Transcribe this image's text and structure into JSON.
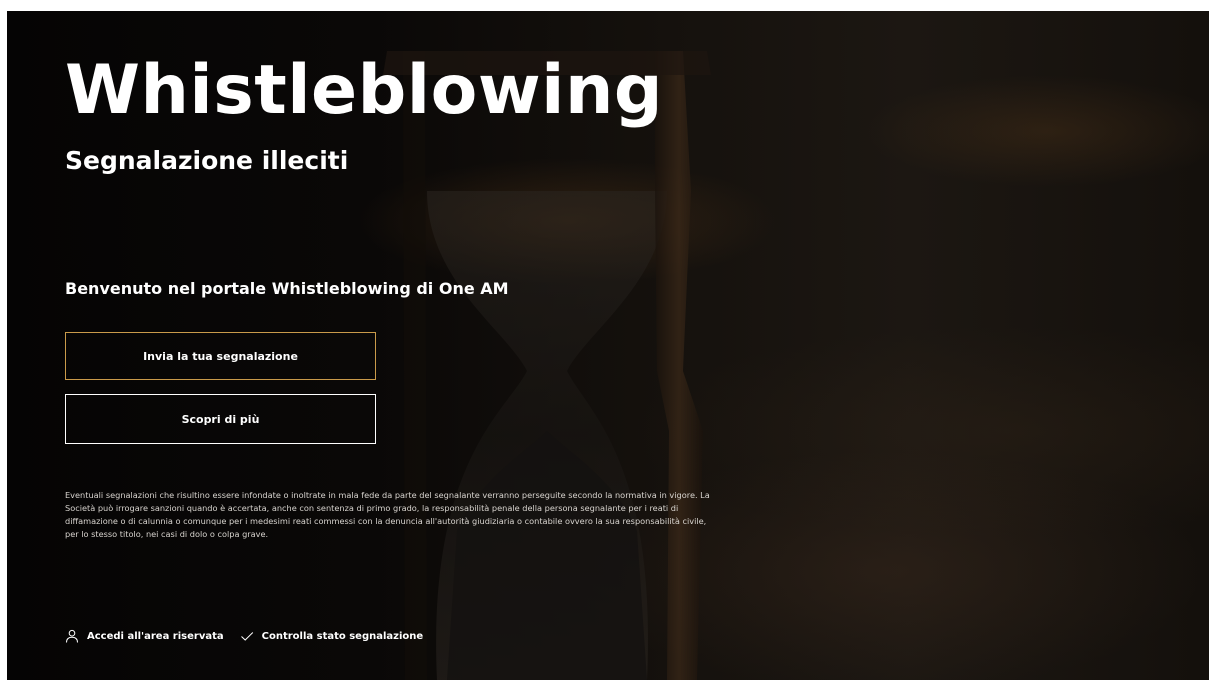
{
  "header": {
    "title": "Whistleblowing",
    "subtitle": "Segnalazione illeciti"
  },
  "main": {
    "welcome": "Benvenuto nel portale Whistleblowing di One AM",
    "primary_button": "Invia la tua segnalazione",
    "secondary_button": "Scopri di più",
    "disclaimer": "Eventuali segnalazioni che risultino essere infondate o inoltrate in mala fede da parte del segnalante verranno perseguite secondo la normativa in vigore. La Società può irrogare sanzioni quando è accertata, anche con sentenza di primo grado, la responsabilità penale della persona segnalante per i reati di diffamazione o di calunnia o comunque per i medesimi reati commessi con la denuncia all'autorità giudiziaria o contabile ovvero la sua responsabilità civile, per lo stesso titolo, nei casi di dolo o colpa grave."
  },
  "footer": {
    "reserved_area": {
      "label": "Accedi all'area riservata",
      "icon": "user-icon"
    },
    "check_status": {
      "label": "Controlla stato segnalazione",
      "icon": "check-icon"
    }
  },
  "colors": {
    "background": "#0a0807",
    "text": "#ffffff",
    "primary_button_border": "#c99a4a"
  }
}
